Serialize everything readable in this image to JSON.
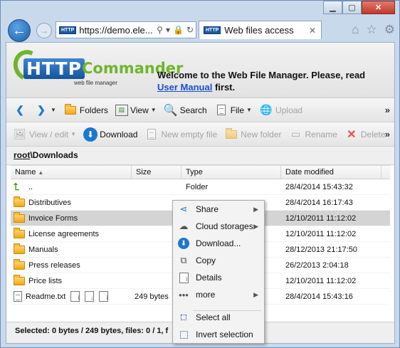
{
  "browser": {
    "url": "https://demo.ele...",
    "tab_title": "Web files access",
    "http_badge": "HTTP"
  },
  "banner": {
    "logo_http": "HTTP",
    "logo_commander": "Commander",
    "logo_sub": "web file manager",
    "welcome_text": "Welcome to the Web File Manager. Please, read",
    "welcome_link": "User Manual",
    "welcome_suffix": "first."
  },
  "toolbar1": {
    "folders": "Folders",
    "view": "View",
    "search": "Search",
    "file": "File",
    "upload": "Upload"
  },
  "toolbar2": {
    "view_edit": "View / edit",
    "download": "Download",
    "new_empty_file": "New empty file",
    "new_folder": "New folder",
    "rename": "Rename",
    "delete": "Delete"
  },
  "breadcrumb": {
    "root": "root",
    "separator": "\\",
    "current": "Downloads"
  },
  "grid": {
    "columns": [
      "Name",
      "Size",
      "Type",
      "Date modified"
    ],
    "rows": [
      {
        "name": "..",
        "size": "",
        "type": "Folder",
        "date": "28/4/2014 15:43:32"
      },
      {
        "name": "Distributives",
        "size": "",
        "type": "",
        "date": "28/4/2014 16:17:43"
      },
      {
        "name": "Invoice Forms",
        "size": "",
        "type": "",
        "date": "12/10/2011 11:12:02"
      },
      {
        "name": "License agreements",
        "size": "",
        "type": "",
        "date": "12/10/2011 11:12:02"
      },
      {
        "name": "Manuals",
        "size": "",
        "type": "",
        "date": "28/12/2013 21:17:50"
      },
      {
        "name": "Press releases",
        "size": "",
        "type": "",
        "date": "26/2/2013 2:04:18"
      },
      {
        "name": "Price lists",
        "size": "",
        "type": "",
        "date": "12/10/2011 11:12:02"
      },
      {
        "name": "Readme.txt",
        "size": "249 bytes",
        "type": "",
        "date": "28/4/2014 15:43:16"
      }
    ]
  },
  "status": {
    "text": "Selected: 0 bytes / 249 bytes, files: 0 / 1, f"
  },
  "context_menu": {
    "share": "Share",
    "cloud_storages": "Cloud storages",
    "download": "Download...",
    "copy": "Copy",
    "details": "Details",
    "more": "more",
    "select_all": "Select all",
    "invert_selection": "Invert selection"
  }
}
